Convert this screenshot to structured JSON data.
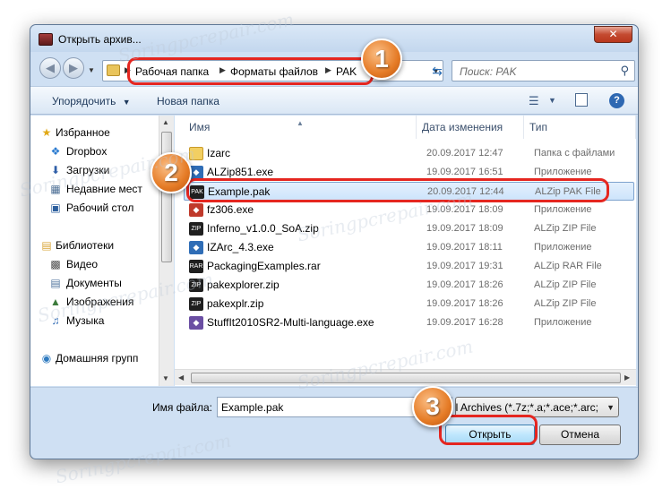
{
  "window": {
    "title": "Открыть архив...",
    "close_label": "✕"
  },
  "navigation": {
    "back_icon": "back-arrow-icon",
    "forward_icon": "forward-arrow-icon",
    "breadcrumbs": [
      "Рабочая папка",
      "Форматы файлов",
      "PAK"
    ],
    "search_placeholder": "Поиск: PAK"
  },
  "toolbar": {
    "organize_label": "Упорядочить",
    "new_folder_label": "Новая папка"
  },
  "sidebar": {
    "items": [
      {
        "label": "Избранное",
        "icon": "star-icon"
      },
      {
        "label": "Dropbox",
        "icon": "dropbox-icon"
      },
      {
        "label": "Загрузки",
        "icon": "downloads-icon"
      },
      {
        "label": "Недавние мест",
        "icon": "recent-places-icon"
      },
      {
        "label": "Рабочий стол",
        "icon": "desktop-icon"
      },
      {
        "label": "Библиотеки",
        "icon": "libraries-icon"
      },
      {
        "label": "Видео",
        "icon": "video-icon"
      },
      {
        "label": "Документы",
        "icon": "documents-icon"
      },
      {
        "label": "Изображения",
        "icon": "images-icon"
      },
      {
        "label": "Музыка",
        "icon": "music-icon"
      },
      {
        "label": "Домашняя групп",
        "icon": "homegroup-icon"
      }
    ]
  },
  "filelist": {
    "columns": [
      "Имя",
      "Дата изменения",
      "Тип"
    ],
    "rows": [
      {
        "name": "Izarc",
        "date": "20.09.2017 12:47",
        "type": "Папка с файлами",
        "icon": "folder-icon"
      },
      {
        "name": "ALZip851.exe",
        "date": "19.09.2017 16:51",
        "type": "Приложение",
        "icon": "exe-icon"
      },
      {
        "name": "Example.pak",
        "date": "20.09.2017 12:44",
        "type": "ALZip PAK File",
        "icon": "pak-icon"
      },
      {
        "name": "fz306.exe",
        "date": "19.09.2017 18:09",
        "type": "Приложение",
        "icon": "exe-icon"
      },
      {
        "name": "Inferno_v1.0.0_SoA.zip",
        "date": "19.09.2017 18:09",
        "type": "ALZip ZIP File",
        "icon": "zip-icon"
      },
      {
        "name": "IZArc_4.3.exe",
        "date": "19.09.2017 18:11",
        "type": "Приложение",
        "icon": "exe-icon"
      },
      {
        "name": "PackagingExamples.rar",
        "date": "19.09.2017 19:31",
        "type": "ALZip RAR File",
        "icon": "rar-icon"
      },
      {
        "name": "pakexplorer.zip",
        "date": "19.09.2017 18:26",
        "type": "ALZip ZIP File",
        "icon": "zip-icon"
      },
      {
        "name": "pakexplr.zip",
        "date": "19.09.2017 18:26",
        "type": "ALZip ZIP File",
        "icon": "zip-icon"
      },
      {
        "name": "StuffIt2010SR2-Multi-language.exe",
        "date": "19.09.2017 16:28",
        "type": "Приложение",
        "icon": "exe-icon"
      }
    ],
    "selected_index": 2
  },
  "footer": {
    "filename_label": "Имя файла:",
    "filename_value": "Example.pak",
    "filter_value": "All Archives (*.7z;*.a;*.ace;*.arc;",
    "open_label": "Открыть",
    "cancel_label": "Отмена"
  },
  "callouts": [
    "1",
    "2",
    "3"
  ],
  "watermark": "Soringpcrepair.com",
  "colors": {
    "callout": "#e52620",
    "badge": "#e57b26",
    "selection": "#cde4fb"
  }
}
